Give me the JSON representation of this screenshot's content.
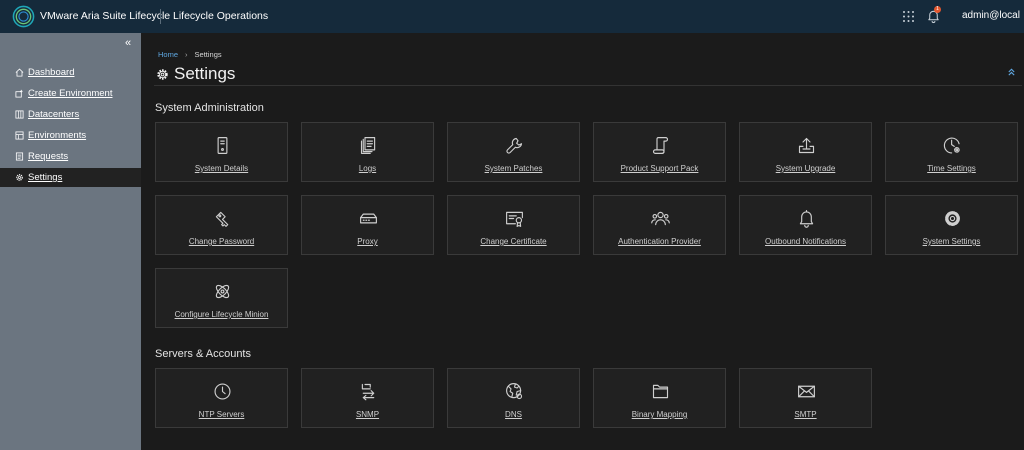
{
  "header": {
    "app_title": "VMware Aria Suite Lifecycle",
    "product": "Lifecycle Operations",
    "notification_count": "1",
    "user": "admin@local"
  },
  "sidebar": {
    "items": [
      {
        "label": "Dashboard",
        "icon": "home-icon",
        "active": false
      },
      {
        "label": "Create Environment",
        "icon": "create-environment-icon",
        "active": false
      },
      {
        "label": "Datacenters",
        "icon": "datacenter-icon",
        "active": false
      },
      {
        "label": "Environments",
        "icon": "environments-icon",
        "active": false
      },
      {
        "label": "Requests",
        "icon": "requests-icon",
        "active": false
      },
      {
        "label": "Settings",
        "icon": "gear-icon",
        "active": true
      }
    ]
  },
  "breadcrumb": {
    "home": "Home",
    "current": "Settings"
  },
  "page": {
    "title": "Settings"
  },
  "sections": [
    {
      "title": "System Administration",
      "tiles": [
        {
          "label": "System Details",
          "icon": "server-icon"
        },
        {
          "label": "Logs",
          "icon": "logs-icon"
        },
        {
          "label": "System Patches",
          "icon": "wrench-icon"
        },
        {
          "label": "Product Support Pack",
          "icon": "scroll-icon"
        },
        {
          "label": "System Upgrade",
          "icon": "upload-tray-icon"
        },
        {
          "label": "Time Settings",
          "icon": "clock-gear-icon"
        },
        {
          "label": "Change Password",
          "icon": "key-icon"
        },
        {
          "label": "Proxy",
          "icon": "network-device-icon"
        },
        {
          "label": "Change Certificate",
          "icon": "certificate-icon"
        },
        {
          "label": "Authentication Provider",
          "icon": "users-icon"
        },
        {
          "label": "Outbound Notifications",
          "icon": "bell-icon"
        },
        {
          "label": "System Settings",
          "icon": "gear-icon"
        },
        {
          "label": "Configure Lifecycle Minion",
          "icon": "atom-icon"
        }
      ]
    },
    {
      "title": "Servers & Accounts",
      "tiles": [
        {
          "label": "NTP Servers",
          "icon": "clock-icon"
        },
        {
          "label": "SNMP",
          "icon": "snmp-icon"
        },
        {
          "label": "DNS",
          "icon": "globe-icon"
        },
        {
          "label": "Binary Mapping",
          "icon": "folder-icon"
        },
        {
          "label": "SMTP",
          "icon": "envelope-icon"
        }
      ]
    }
  ]
}
